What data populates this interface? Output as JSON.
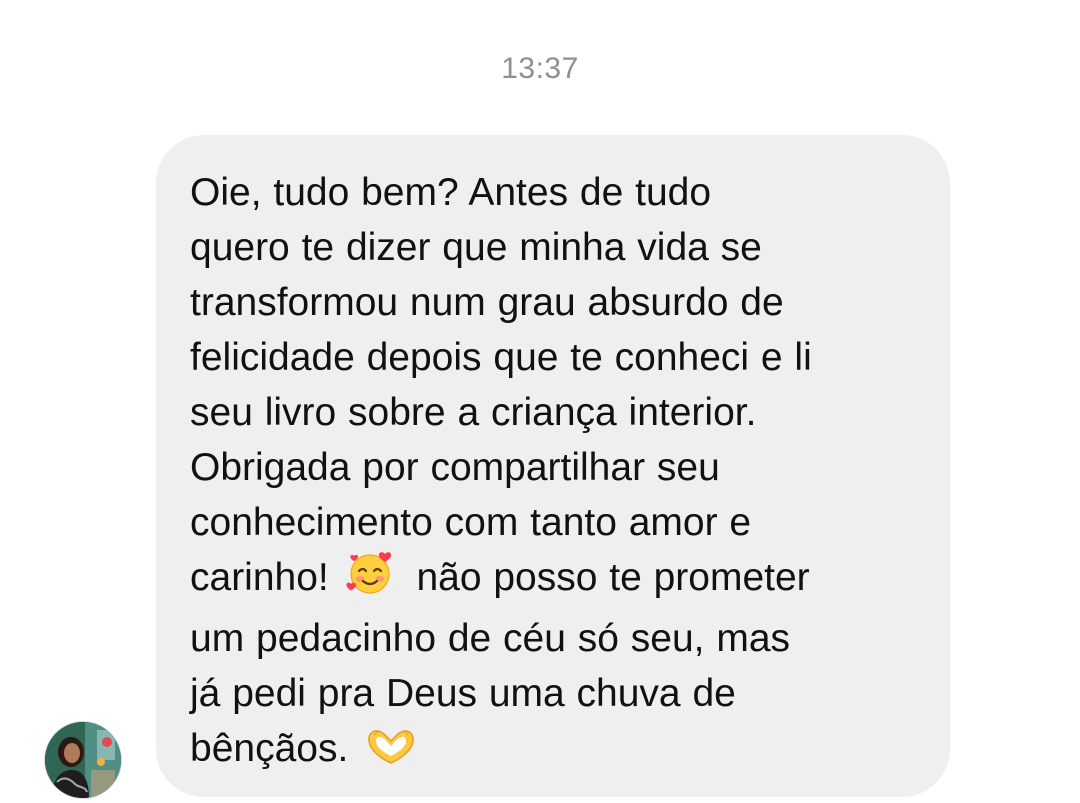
{
  "conversation": {
    "timestamp": "13:37"
  },
  "message": {
    "lines": [
      "Oie, tudo bem? Antes de tudo",
      "quero te dizer que minha vida se",
      "transformou num grau absurdo de",
      "felicidade depois que te conheci e li",
      "seu livro sobre a criança interior.",
      "Obrigada por compartilhar seu",
      "conhecimento com tanto amor e",
      "carinho!",
      "não posso te prometer",
      "um pedacinho de céu só seu, mas",
      "já pedi pra Deus uma chuva de",
      "bênçãos."
    ],
    "emojis": [
      "smiling-face-with-hearts",
      "heart-hands"
    ]
  },
  "sender": {
    "avatar": "profile-photo"
  },
  "colors": {
    "bubble": "#efefef",
    "timestamp": "#8e8e93",
    "text": "#111111"
  }
}
